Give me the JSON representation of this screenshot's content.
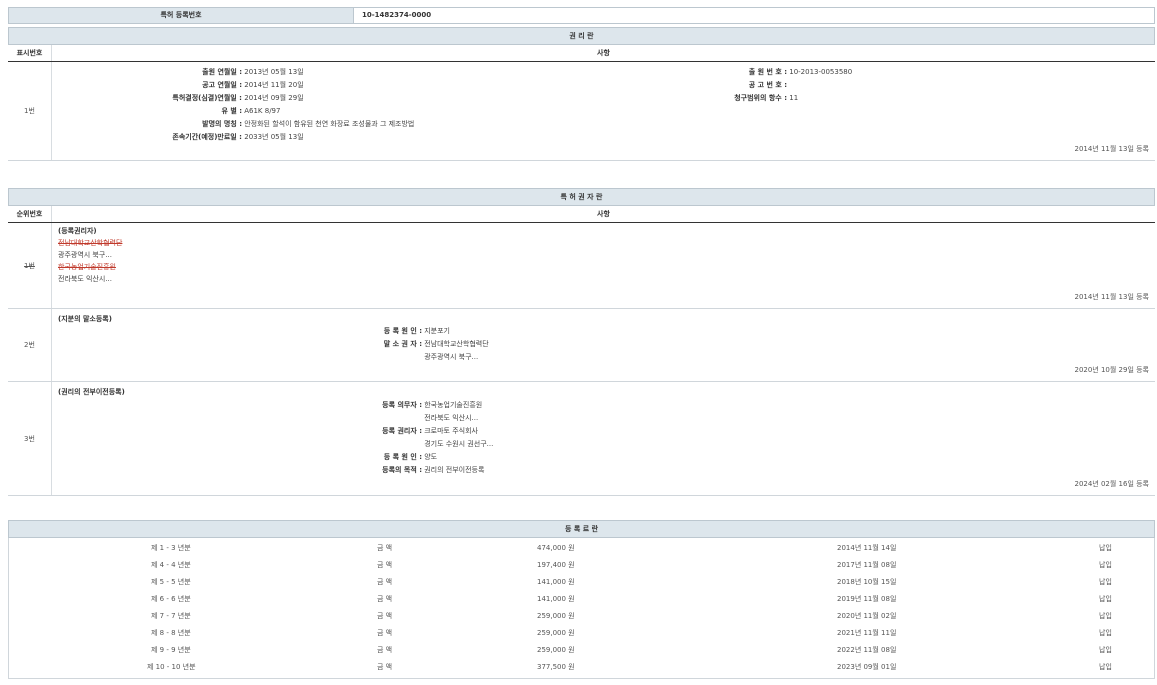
{
  "registration": {
    "label": "특허 등록번호",
    "value": "10-1482374-0000"
  },
  "rights_section": {
    "title": "권 리 란",
    "col_num": "표시번호",
    "col_content": "사항",
    "row": {
      "num": "1번",
      "left": [
        {
          "label": "출원 연월일 :",
          "value": "2013년 05월 13일"
        },
        {
          "label": "공고 연월일 :",
          "value": "2014년 11월 20일"
        },
        {
          "label": "특허결정(심결)연월일 :",
          "value": "2014년 09월 29일"
        },
        {
          "label": "유 별 :",
          "value": "A61K 8/97"
        },
        {
          "label": "발명의 명칭 :",
          "value": "안정화된 할석이 함유된 천연 화장료 조성물과 그 제조방법"
        },
        {
          "label": "존속기간(예정)만료일 :",
          "value": "2033년 05월 13일"
        }
      ],
      "right": [
        {
          "label": "출 원 번 호 :",
          "value": "10-2013-0053580"
        },
        {
          "label": "공 고 번 호 :",
          "value": ""
        },
        {
          "label": "청구범위의 항수 :",
          "value": "11"
        }
      ],
      "reg_date": "2014년 11월 13일 등록"
    }
  },
  "holder_section": {
    "title": "특 허 권 자 란",
    "col_num": "순위번호",
    "col_content": "사항",
    "rows": [
      {
        "num": "1번",
        "heading": "(등록권리자)",
        "lines": [
          "전남대학교산학협력단",
          "광주광역시 북구...",
          "한국농업기술진흥원",
          "전라북도 익산시..."
        ],
        "reg_date": "2014년 11월 13일 등록"
      },
      {
        "num": "2번",
        "heading": "(지분의 말소등록)",
        "fields": [
          {
            "label": "등 록 원 인 :",
            "value": "지분포기"
          },
          {
            "label": "말 소 권 자 :",
            "value": "전남대학교산학협력단"
          },
          {
            "label": "",
            "value": "광주광역시 북구..."
          }
        ],
        "reg_date": "2020년 10월 29일 등록"
      },
      {
        "num": "3번",
        "heading": "(권리의 전부이전등록)",
        "fields": [
          {
            "label": "등록 의무자 :",
            "value": "한국농업기술진흥원"
          },
          {
            "label": "",
            "value": "전라북도 익산시..."
          },
          {
            "label": "등록 권리자 :",
            "value": "크로마토 주식회사"
          },
          {
            "label": "",
            "value": "경기도 수원시 권선구..."
          },
          {
            "label": "등 록 원 인 :",
            "value": "양도"
          },
          {
            "label": "등록의 목적 :",
            "value": "권리의 전부이전등록"
          }
        ],
        "reg_date": "2024년 02월 16일 등록"
      }
    ]
  },
  "fee_section": {
    "title": "등 록 료 란",
    "rows": [
      {
        "period": "제 1 - 3 년분",
        "label": "금 액",
        "amount": "474,000 원",
        "date": "2014년 11월 14일",
        "status": "납입"
      },
      {
        "period": "제 4 - 4 년분",
        "label": "금 액",
        "amount": "197,400 원",
        "date": "2017년 11월 08일",
        "status": "납입"
      },
      {
        "period": "제 5 - 5 년분",
        "label": "금 액",
        "amount": "141,000 원",
        "date": "2018년 10월 15일",
        "status": "납입"
      },
      {
        "period": "제 6 - 6 년분",
        "label": "금 액",
        "amount": "141,000 원",
        "date": "2019년 11월 08일",
        "status": "납입"
      },
      {
        "period": "제 7 - 7 년분",
        "label": "금 액",
        "amount": "259,000 원",
        "date": "2020년 11월 02일",
        "status": "납입"
      },
      {
        "period": "제 8 - 8 년분",
        "label": "금 액",
        "amount": "259,000 원",
        "date": "2021년 11월 11일",
        "status": "납입"
      },
      {
        "period": "제 9 - 9 년분",
        "label": "금 액",
        "amount": "259,000 원",
        "date": "2022년 11월 08일",
        "status": "납입"
      },
      {
        "period": "제 10 - 10 년분",
        "label": "금 액",
        "amount": "377,500 원",
        "date": "2023년 09월 01일",
        "status": "납입"
      }
    ]
  }
}
